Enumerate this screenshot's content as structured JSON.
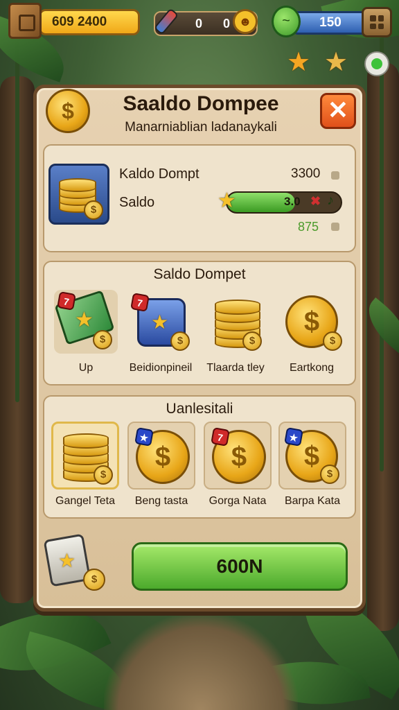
{
  "hud": {
    "gold": "609 2400",
    "counter_a": "0",
    "counter_b": "0",
    "gems": "150"
  },
  "dialog": {
    "title": "Saaldo Dompee",
    "subtitle": "Manarniablian ladanaykali",
    "close_label": "✕"
  },
  "balance": {
    "wallet_label": "Kaldo Dompt",
    "wallet_value": "3300",
    "saldo_label": "Saldo",
    "progress_text": "3.0",
    "progress_fraction": 0.6,
    "green_value": "875"
  },
  "items": {
    "title": "Saldo Dompet",
    "list": [
      {
        "label": "Up",
        "icon": "cash-bundle-icon",
        "tag": "red"
      },
      {
        "label": "Beidionpineil",
        "icon": "jar-icon",
        "tag": "red"
      },
      {
        "label": "Tlaarda tley",
        "icon": "coin-stack-icon",
        "tag": ""
      },
      {
        "label": "Eartkong",
        "icon": "gold-coin-icon",
        "tag": ""
      }
    ]
  },
  "unlocks": {
    "title": "Uanlesitali",
    "list": [
      {
        "label": "Gangel Teta",
        "icon": "coin-stack-icon",
        "tag": ""
      },
      {
        "label": "Beng tasta",
        "icon": "gold-coin-icon",
        "tag": "blue"
      },
      {
        "label": "Gorga Nata",
        "icon": "gold-coin-icon",
        "tag": "red"
      },
      {
        "label": "Barpa Kata",
        "icon": "gold-coin-icon",
        "tag": "blue"
      }
    ]
  },
  "action": {
    "button_label": "600N"
  },
  "colors": {
    "panel": "#e7d2b2",
    "accent_green": "#4caa2c",
    "gold": "#f0a818",
    "close": "#e0501a"
  }
}
